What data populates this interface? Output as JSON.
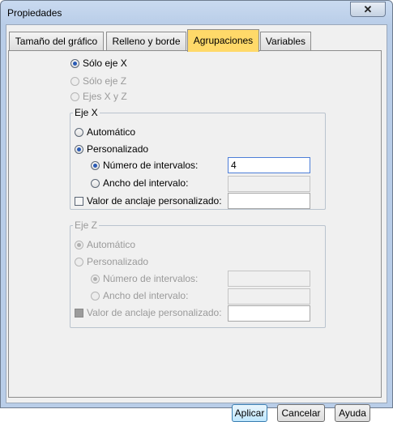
{
  "window": {
    "title": "Propiedades",
    "close_label": "✕"
  },
  "tabs": [
    {
      "label": "Tamaño del gráfico",
      "active": false
    },
    {
      "label": "Relleno y borde",
      "active": false
    },
    {
      "label": "Agrupaciones",
      "active": true
    },
    {
      "label": "Variables",
      "active": false
    }
  ],
  "axis_options": {
    "x_only": {
      "label": "Sólo eje X",
      "checked": true,
      "enabled": true
    },
    "z_only": {
      "label": "Sólo eje Z",
      "checked": false,
      "enabled": false
    },
    "xz": {
      "label": "Ejes X y Z",
      "checked": false,
      "enabled": false
    }
  },
  "x_group": {
    "legend": "Eje X",
    "automatic": {
      "label": "Automático",
      "checked": false
    },
    "custom": {
      "label": "Personalizado",
      "checked": true
    },
    "num_intervals": {
      "label": "Número de intervalos:",
      "checked": true,
      "value": "4"
    },
    "interval_width": {
      "label": "Ancho del intervalo:",
      "checked": false,
      "value": ""
    },
    "anchor": {
      "label": "Valor de anclaje personalizado:",
      "checked": false,
      "value": ""
    }
  },
  "z_group": {
    "legend": "Eje Z",
    "automatic": {
      "label": "Automático",
      "checked": true
    },
    "custom": {
      "label": "Personalizado",
      "checked": false
    },
    "num_intervals": {
      "label": "Número de intervalos:",
      "checked": true,
      "value": ""
    },
    "interval_width": {
      "label": "Ancho del intervalo:",
      "checked": false,
      "value": ""
    },
    "anchor": {
      "label": "Valor de anclaje personalizado:",
      "checked": false,
      "value": ""
    }
  },
  "buttons": {
    "apply": "Aplicar",
    "cancel": "Cancelar",
    "help": "Ayuda"
  }
}
